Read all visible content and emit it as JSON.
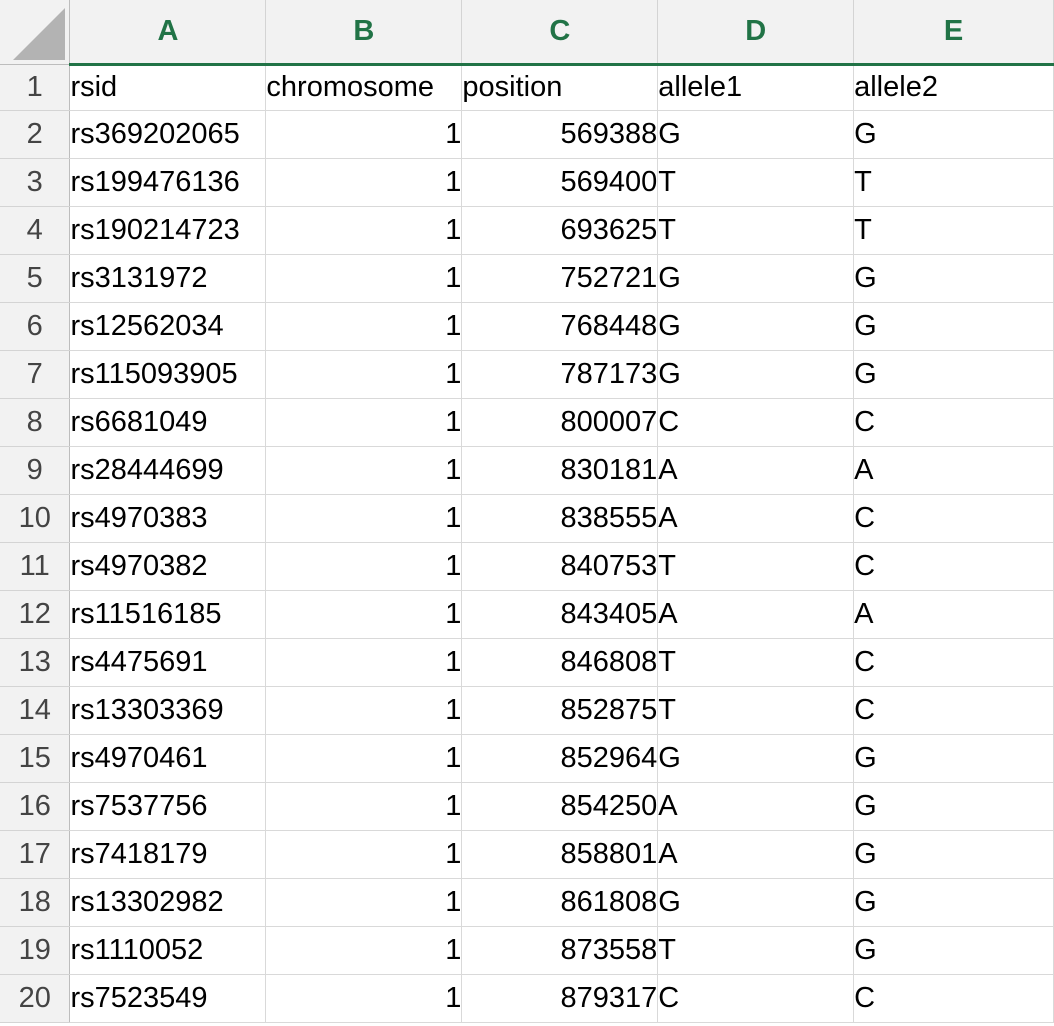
{
  "columns": [
    "A",
    "B",
    "C",
    "D",
    "E"
  ],
  "header_row": {
    "row_number": "1",
    "cells": [
      "rsid",
      "chromosome",
      "position",
      "allele1",
      "allele2"
    ]
  },
  "rows": [
    {
      "n": "2",
      "rsid": "rs369202065",
      "chromosome": "1",
      "position": "569388",
      "allele1": "G",
      "allele2": "G"
    },
    {
      "n": "3",
      "rsid": "rs199476136",
      "chromosome": "1",
      "position": "569400",
      "allele1": "T",
      "allele2": "T"
    },
    {
      "n": "4",
      "rsid": "rs190214723",
      "chromosome": "1",
      "position": "693625",
      "allele1": "T",
      "allele2": "T"
    },
    {
      "n": "5",
      "rsid": "rs3131972",
      "chromosome": "1",
      "position": "752721",
      "allele1": "G",
      "allele2": "G"
    },
    {
      "n": "6",
      "rsid": "rs12562034",
      "chromosome": "1",
      "position": "768448",
      "allele1": "G",
      "allele2": "G"
    },
    {
      "n": "7",
      "rsid": "rs115093905",
      "chromosome": "1",
      "position": "787173",
      "allele1": "G",
      "allele2": "G"
    },
    {
      "n": "8",
      "rsid": "rs6681049",
      "chromosome": "1",
      "position": "800007",
      "allele1": "C",
      "allele2": "C"
    },
    {
      "n": "9",
      "rsid": "rs28444699",
      "chromosome": "1",
      "position": "830181",
      "allele1": "A",
      "allele2": "A"
    },
    {
      "n": "10",
      "rsid": "rs4970383",
      "chromosome": "1",
      "position": "838555",
      "allele1": "A",
      "allele2": "C"
    },
    {
      "n": "11",
      "rsid": "rs4970382",
      "chromosome": "1",
      "position": "840753",
      "allele1": "T",
      "allele2": "C"
    },
    {
      "n": "12",
      "rsid": "rs11516185",
      "chromosome": "1",
      "position": "843405",
      "allele1": "A",
      "allele2": "A"
    },
    {
      "n": "13",
      "rsid": "rs4475691",
      "chromosome": "1",
      "position": "846808",
      "allele1": "T",
      "allele2": "C"
    },
    {
      "n": "14",
      "rsid": "rs13303369",
      "chromosome": "1",
      "position": "852875",
      "allele1": "T",
      "allele2": "C"
    },
    {
      "n": "15",
      "rsid": "rs4970461",
      "chromosome": "1",
      "position": "852964",
      "allele1": "G",
      "allele2": "G"
    },
    {
      "n": "16",
      "rsid": "rs7537756",
      "chromosome": "1",
      "position": "854250",
      "allele1": "A",
      "allele2": "G"
    },
    {
      "n": "17",
      "rsid": "rs7418179",
      "chromosome": "1",
      "position": "858801",
      "allele1": "A",
      "allele2": "G"
    },
    {
      "n": "18",
      "rsid": "rs13302982",
      "chromosome": "1",
      "position": "861808",
      "allele1": "G",
      "allele2": "G"
    },
    {
      "n": "19",
      "rsid": "rs1110052",
      "chromosome": "1",
      "position": "873558",
      "allele1": "T",
      "allele2": "G"
    },
    {
      "n": "20",
      "rsid": "rs7523549",
      "chromosome": "1",
      "position": "879317",
      "allele1": "C",
      "allele2": "C"
    }
  ],
  "colors": {
    "header_text": "#217346",
    "header_underline": "#217346",
    "header_background": "#f2f2f2",
    "grid_line": "#d9d9d9"
  }
}
